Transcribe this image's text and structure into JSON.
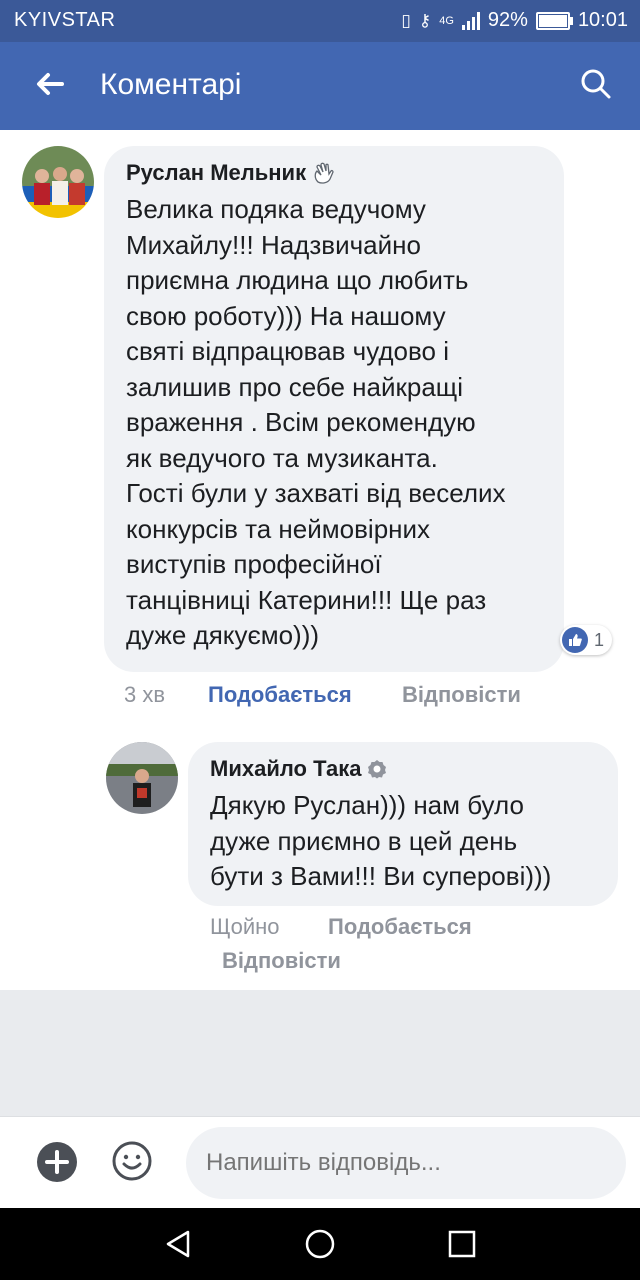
{
  "status": {
    "carrier": "KYIVSTAR",
    "network": "4G",
    "battery": "92%",
    "time": "10:01"
  },
  "header": {
    "title": "Коментарі"
  },
  "comments": [
    {
      "author": "Руслан Мельник",
      "text": "Велика подяка ведучому\nМихайлу!!! Надзвичайно\nприємна людина що любить\nсвою роботу))) На нашому\nсвяті відпрацював чудово і\nзалишив про себе найкращі\nвраження . Всім рекомендую\nяк ведучого та музиканта.\nГості були у захваті від веселих\nконкурсів та неймовірних\nвиступів професійної\nтанцівниці Катерини!!!  Ще раз\nдуже дякуємо)))",
      "time": "3 хв",
      "like_label": "Подобається",
      "reply_label": "Відповісти",
      "reaction_count": "1"
    }
  ],
  "reply": {
    "author": "Михайло Така",
    "text": "Дякую Руслан))) нам було\nдуже приємно в цей день\nбути з Вами!!! Ви суперові)))",
    "time": "Щойно",
    "like_label": "Подобається",
    "reply_label": "Відповісти"
  },
  "composer": {
    "placeholder": "Напишіть відповідь..."
  },
  "colors": {
    "brand": "#4267b2",
    "status_bar": "#3b5998",
    "bubble": "#f0f2f5"
  }
}
